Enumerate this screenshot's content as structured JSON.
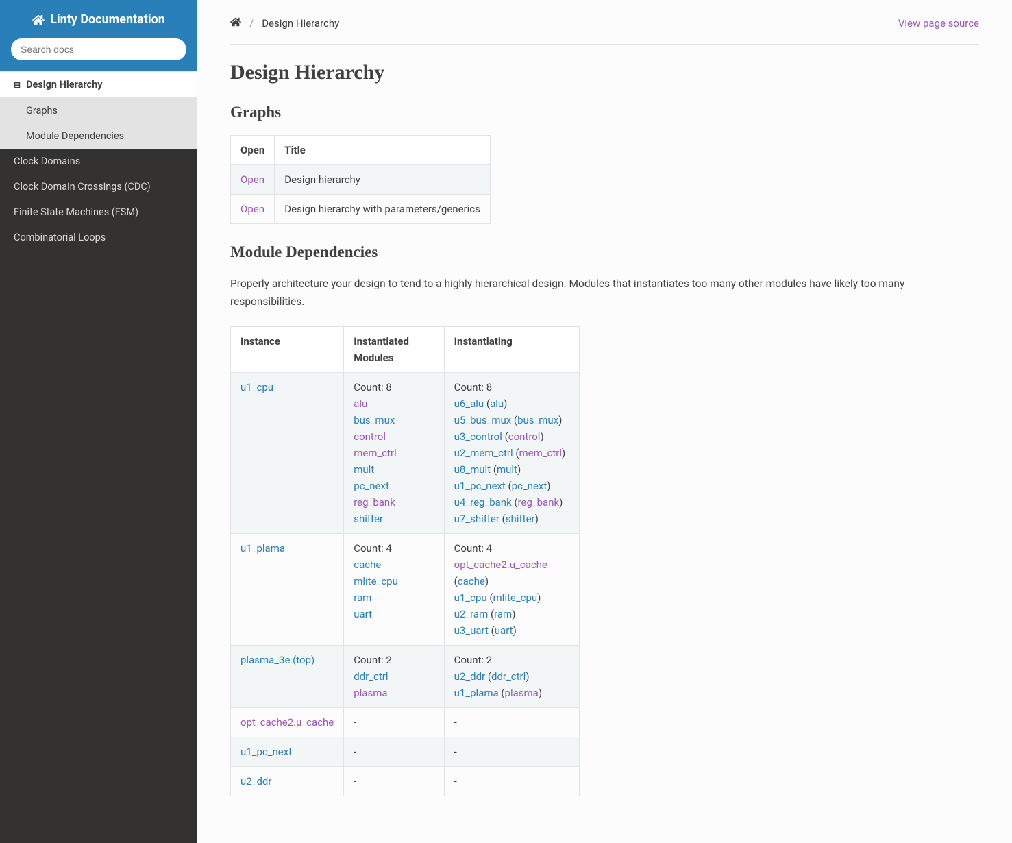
{
  "site": {
    "title": "Linty Documentation"
  },
  "search": {
    "placeholder": "Search docs"
  },
  "nav": {
    "items": [
      {
        "label": "Design Hierarchy",
        "current": true,
        "expandable": true
      },
      {
        "label": "Graphs",
        "sub": true
      },
      {
        "label": "Module Dependencies",
        "sub": true
      },
      {
        "label": "Clock Domains"
      },
      {
        "label": "Clock Domain Crossings (CDC)"
      },
      {
        "label": "Finite State Machines (FSM)"
      },
      {
        "label": "Combinatorial Loops"
      }
    ]
  },
  "breadcrumb": {
    "page": "Design Hierarchy"
  },
  "view_source": "View page source",
  "headings": {
    "h1": "Design Hierarchy",
    "h2a": "Graphs",
    "h2b": "Module Dependencies"
  },
  "graphs_table": {
    "head": {
      "c0": "Open",
      "c1": "Title"
    },
    "rows": [
      {
        "open": "Open",
        "title": "Design hierarchy"
      },
      {
        "open": "Open",
        "title": "Design hierarchy with parameters/generics"
      }
    ]
  },
  "module_deps_intro": "Properly architecture your design to tend to a highly hierarchical design. Modules that instantiates too many other modules have likely too many responsibilities.",
  "deps_table": {
    "head": {
      "c0": "Instance",
      "c1": "Instantiated Modules",
      "c2": "Instantiating"
    },
    "rows": [
      {
        "instance": "u1_cpu",
        "instance_link": "blue",
        "instantiated_count": "Count: 8",
        "instantiated": [
          "alu",
          "bus_mux",
          "control",
          "mem_ctrl",
          "mult",
          "pc_next",
          "reg_bank",
          "shifter"
        ],
        "instantiated_colors": [
          "purple",
          "blue",
          "purple",
          "purple",
          "blue",
          "blue",
          "purple",
          "blue"
        ],
        "instantiating_count": "Count: 8",
        "instantiating": [
          {
            "inst": "u6_alu",
            "mod": "alu"
          },
          {
            "inst": "u5_bus_mux",
            "mod": "bus_mux"
          },
          {
            "inst": "u3_control",
            "mod": "control"
          },
          {
            "inst": "u2_mem_ctrl",
            "mod": "mem_ctrl"
          },
          {
            "inst": "u8_mult",
            "mod": "mult"
          },
          {
            "inst": "u1_pc_next",
            "mod": "pc_next"
          },
          {
            "inst": "u4_reg_bank",
            "mod": "reg_bank"
          },
          {
            "inst": "u7_shifter",
            "mod": "shifter"
          }
        ],
        "instantiating_mod_colors": [
          "blue",
          "blue",
          "purple",
          "purple",
          "blue",
          "blue",
          "purple",
          "blue"
        ]
      },
      {
        "instance": "u1_plama",
        "instance_link": "blue",
        "instantiated_count": "Count: 4",
        "instantiated": [
          "cache",
          "mlite_cpu",
          "ram",
          "uart"
        ],
        "instantiated_colors": [
          "blue",
          "blue",
          "blue",
          "blue"
        ],
        "instantiating_count": "Count: 4",
        "instantiating": [
          {
            "inst": "opt_cache2.u_cache",
            "mod": "cache",
            "inst_color": "purple"
          },
          {
            "inst": "u1_cpu",
            "mod": "mlite_cpu"
          },
          {
            "inst": "u2_ram",
            "mod": "ram"
          },
          {
            "inst": "u3_uart",
            "mod": "uart"
          }
        ],
        "instantiating_mod_colors": [
          "blue",
          "blue",
          "blue",
          "blue"
        ]
      },
      {
        "instance": "plasma_3e (top)",
        "instance_link": "blue",
        "instantiated_count": "Count: 2",
        "instantiated": [
          "ddr_ctrl",
          "plasma"
        ],
        "instantiated_colors": [
          "blue",
          "purple"
        ],
        "instantiating_count": "Count: 2",
        "instantiating": [
          {
            "inst": "u2_ddr",
            "mod": "ddr_ctrl"
          },
          {
            "inst": "u1_plama",
            "mod": "plasma",
            "mod_color": "purple"
          }
        ],
        "instantiating_mod_colors": [
          "blue",
          "purple"
        ]
      },
      {
        "instance": "opt_cache2.u_cache",
        "instance_link": "purple",
        "dash": true
      },
      {
        "instance": "u1_pc_next",
        "instance_link": "blue",
        "dash": true
      },
      {
        "instance": "u2_ddr",
        "instance_link": "blue",
        "dash": true
      }
    ]
  }
}
